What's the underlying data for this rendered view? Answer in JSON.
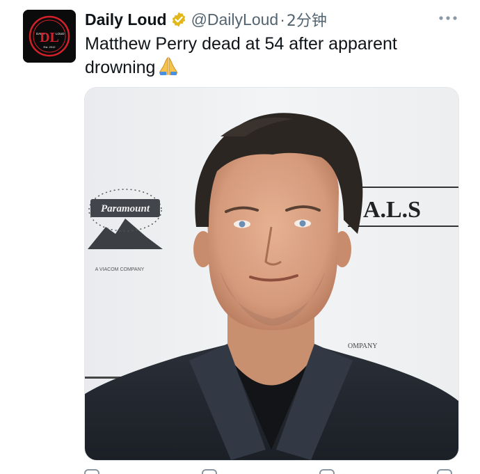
{
  "tweet": {
    "author": {
      "display_name": "Daily Loud",
      "handle": "@DailyLoud",
      "verified": true,
      "verified_color": "#E2B719",
      "avatar_icon": "daily-loud-logo-icon",
      "avatar_logo_text": {
        "monogram": "DL",
        "top_left": "DAILY",
        "top_right": "LOUD",
        "bottom": "Est. 2012"
      },
      "avatar_colors": {
        "background": "#0B0B0B",
        "ring": "#D4202A"
      }
    },
    "separator": "·",
    "timestamp": "2分钟",
    "more_icon": "more-horizontal-icon",
    "text": "Matthew Perry dead at 54 after apparent drowning",
    "emoji": "folded-hands-emoji",
    "media": {
      "kind": "photo",
      "backdrop_texts": {
        "logo": "Paramount",
        "logo_tagline": "A VIACOM COMPANY",
        "banner": "t A.L.S",
        "corner": "OMPANY"
      }
    },
    "actions": [
      {
        "name": "reply",
        "icon": "reply-icon",
        "count": ""
      },
      {
        "name": "retweet",
        "icon": "retweet-icon",
        "count": ""
      },
      {
        "name": "like",
        "icon": "like-icon",
        "count": ""
      },
      {
        "name": "views",
        "icon": "views-icon",
        "count": ""
      }
    ]
  }
}
